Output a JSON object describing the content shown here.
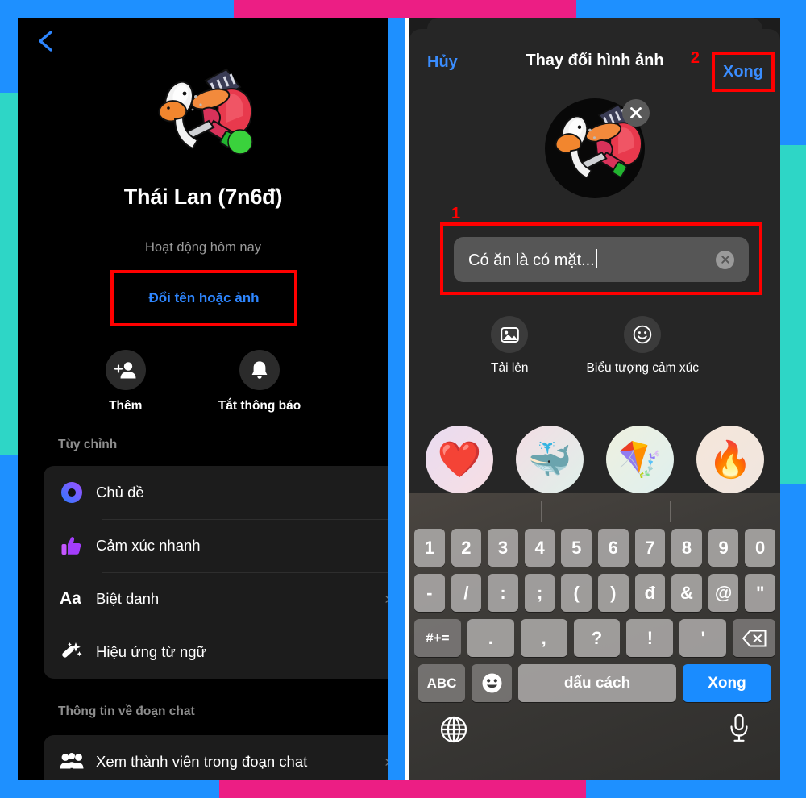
{
  "frame": {
    "blue": "#1e90ff",
    "pink": "#ec1e84",
    "teal": "#2ed6c6",
    "highlight_red": "#ff0000"
  },
  "left_panel": {
    "back_icon": "chevron-left-icon",
    "avatar_alt": "group-avatar",
    "group_title": "Thái Lan (7n6đ)",
    "activity_status": "Hoạt động hôm nay",
    "rename_link": "Đổi tên hoặc ảnh",
    "quick_actions": [
      {
        "icon": "add-person-icon",
        "label": "Thêm"
      },
      {
        "icon": "bell-icon",
        "label": "Tắt thông báo"
      }
    ],
    "sections": [
      {
        "heading": "Tùy chỉnh",
        "rows": [
          {
            "icon": "theme-circle-icon",
            "label": "Chủ đề",
            "chevron": ""
          },
          {
            "icon": "thumbs-up-icon",
            "label": "Cảm xúc nhanh",
            "chevron": ""
          },
          {
            "icon": "aa-text-icon",
            "label": "Biệt danh",
            "chevron": "›"
          },
          {
            "icon": "magic-wand-icon",
            "label": "Hiệu ứng từ ngữ",
            "chevron": ""
          }
        ]
      },
      {
        "heading": "Thông tin về đoạn chat",
        "rows": [
          {
            "icon": "people-group-icon",
            "label": "Xem thành viên trong đoạn chat",
            "chevron": "›"
          }
        ]
      }
    ]
  },
  "right_panel": {
    "cancel_label": "Hủy",
    "title": "Thay đổi hình ảnh",
    "done_label": "Xong",
    "avatar_alt": "edit-group-avatar",
    "remove_photo_icon": "close-x-icon",
    "name_input": {
      "value": "Có ăn là có mặt...",
      "clear_icon": "clear-x-icon"
    },
    "callouts": [
      {
        "number": "1",
        "target": "name-input"
      },
      {
        "number": "2",
        "target": "done-button"
      }
    ],
    "media_actions": [
      {
        "icon": "photo-icon",
        "label": "Tải lên"
      },
      {
        "icon": "smiley-icon",
        "label": "Biểu tượng cảm xúc"
      }
    ],
    "emoji_suggestions": [
      "❤️",
      "🐳",
      "🪁",
      "🔥"
    ]
  },
  "keyboard": {
    "row1": [
      "1",
      "2",
      "3",
      "4",
      "5",
      "6",
      "7",
      "8",
      "9",
      "0"
    ],
    "row2": [
      "-",
      "/",
      ":",
      ";",
      "(",
      ")",
      "đ",
      "&",
      "@",
      "\""
    ],
    "row3": [
      "#+=",
      ".",
      ",",
      "?",
      "!",
      "'",
      "backspace-icon"
    ],
    "row4": {
      "abc": "ABC",
      "emoji": "smiley-key-icon",
      "space": "dấu cách",
      "done": "Xong"
    },
    "bottom": {
      "globe": "globe-icon",
      "mic": "microphone-icon"
    }
  }
}
